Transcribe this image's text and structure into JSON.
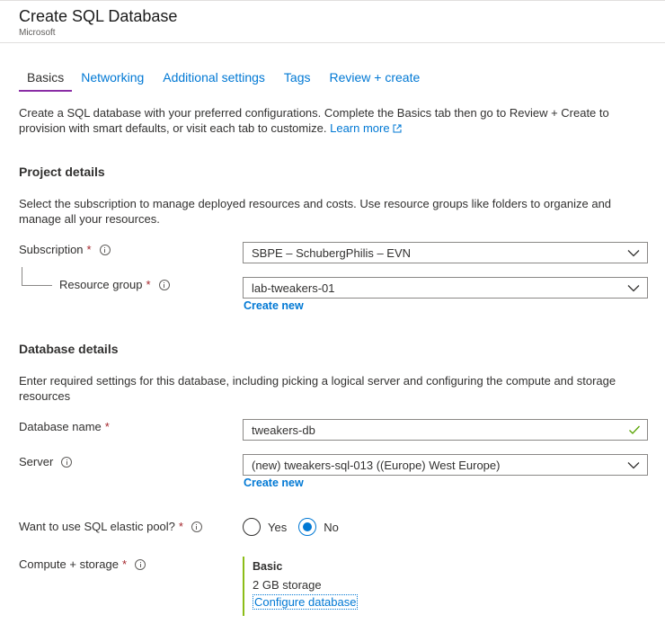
{
  "header": {
    "title": "Create SQL Database",
    "subtitle": "Microsoft"
  },
  "tabs": [
    {
      "label": "Basics",
      "active": true
    },
    {
      "label": "Networking"
    },
    {
      "label": "Additional settings"
    },
    {
      "label": "Tags"
    },
    {
      "label": "Review + create"
    }
  ],
  "intro": {
    "text": "Create a SQL database with your preferred configurations. Complete the Basics tab then go to Review + Create to provision with smart defaults, or visit each tab to customize.",
    "learn_more": "Learn more"
  },
  "project": {
    "title": "Project details",
    "description": "Select the subscription to manage deployed resources and costs. Use resource groups like folders to organize and manage all your resources.",
    "subscription": {
      "label": "Subscription",
      "required": "*",
      "value": "SBPE – SchubergPhilis – EVN"
    },
    "resource_group": {
      "label": "Resource group",
      "required": "*",
      "value": "lab-tweakers-01",
      "create_new": "Create new"
    }
  },
  "database": {
    "title": "Database details",
    "description": "Enter required settings for this database, including picking a logical server and configuring the compute and storage resources",
    "name": {
      "label": "Database name",
      "required": "*",
      "value": "tweakers-db"
    },
    "server": {
      "label": "Server",
      "value": "(new) tweakers-sql-013 ((Europe) West Europe)",
      "create_new": "Create new"
    },
    "elastic_pool": {
      "label": "Want to use SQL elastic pool?",
      "required": "*",
      "options": [
        "Yes",
        "No"
      ],
      "selected": "No"
    },
    "compute": {
      "label": "Compute + storage",
      "required": "*",
      "tier": "Basic",
      "storage": "2 GB storage",
      "configure": "Configure database"
    }
  },
  "colors": {
    "accent": "#0078d4",
    "tab_underline": "#8a2da5",
    "required": "#a4262c",
    "valid": "#8cbd18"
  },
  "icons": [
    "info-icon",
    "chevron-down-icon",
    "checkmark-icon",
    "external-link-icon"
  ]
}
